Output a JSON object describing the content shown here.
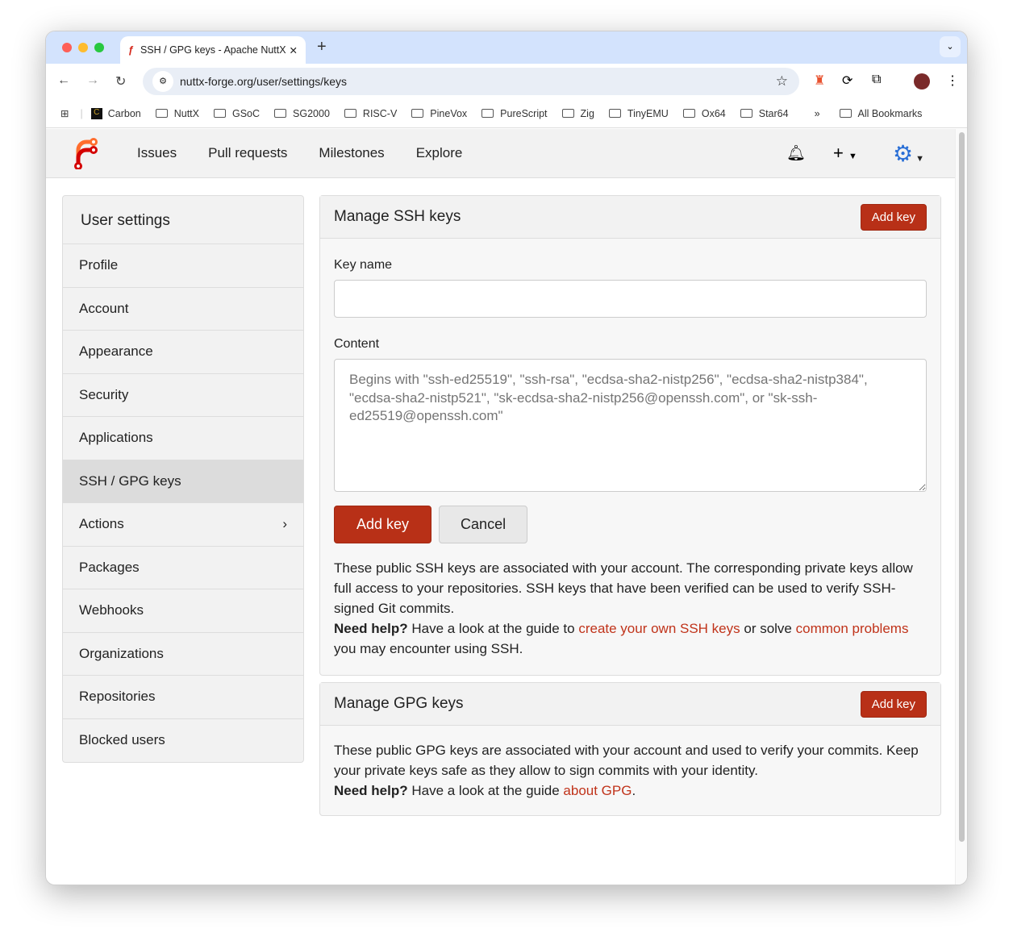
{
  "browser": {
    "tab_title": "SSH / GPG keys - Apache NuttX",
    "url": "nuttx-forge.org/user/settings/keys",
    "bookmarks": [
      "Carbon",
      "NuttX",
      "GSoC",
      "SG2000",
      "RISC-V",
      "PineVox",
      "PureScript",
      "Zig",
      "TinyEMU",
      "Ox64",
      "Star64"
    ],
    "all_bookmarks": "All Bookmarks",
    "more": "»"
  },
  "nav": {
    "items": [
      "Issues",
      "Pull requests",
      "Milestones",
      "Explore"
    ]
  },
  "sidebar": {
    "title": "User settings",
    "items": [
      "Profile",
      "Account",
      "Appearance",
      "Security",
      "Applications",
      "SSH / GPG keys",
      "Actions",
      "Packages",
      "Webhooks",
      "Organizations",
      "Repositories",
      "Blocked users"
    ],
    "active": "SSH / GPG keys"
  },
  "ssh": {
    "title": "Manage SSH keys",
    "add_key": "Add key",
    "key_name_label": "Key name",
    "key_name_value": "",
    "content_label": "Content",
    "content_placeholder": "Begins with \"ssh-ed25519\", \"ssh-rsa\", \"ecdsa-sha2-nistp256\", \"ecdsa-sha2-nistp384\", \"ecdsa-sha2-nistp521\", \"sk-ecdsa-sha2-nistp256@openssh.com\", or \"sk-ssh-ed25519@openssh.com\"",
    "submit": "Add key",
    "cancel": "Cancel",
    "info": "These public SSH keys are associated with your account. The corresponding private keys allow full access to your repositories. SSH keys that have been verified can be used to verify SSH-signed Git commits.",
    "help_bold": "Need help?",
    "help_1": " Have a look at the guide to ",
    "link_1": "create your own SSH keys",
    "help_2": " or solve ",
    "link_2": "common problems",
    "help_3": " you may encounter using SSH."
  },
  "gpg": {
    "title": "Manage GPG keys",
    "add_key": "Add key",
    "info": "These public GPG keys are associated with your account and used to verify your commits. Keep your private keys safe as they allow to sign commits with your identity.",
    "help_bold": "Need help?",
    "help_1": " Have a look at the guide ",
    "link": "about GPG",
    "help_2": "."
  },
  "colors": {
    "accent": "#b83017",
    "link": "#c0331a"
  }
}
